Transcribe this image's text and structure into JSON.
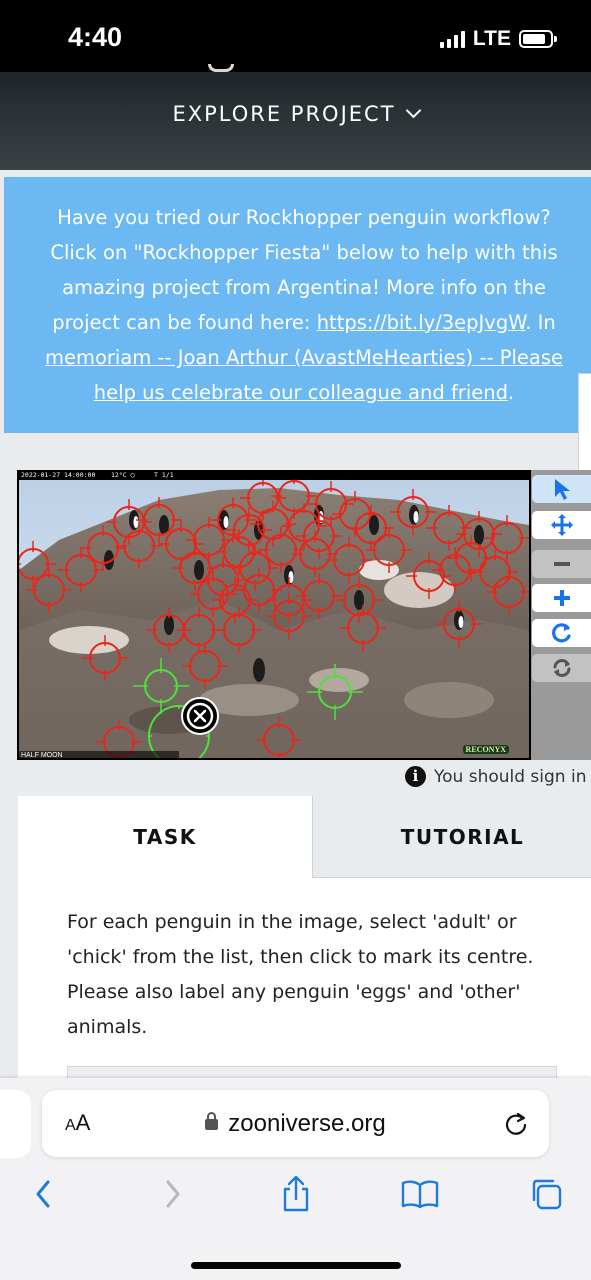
{
  "status_bar": {
    "time": "4:40",
    "network": "LTE"
  },
  "header": {
    "explore_label": "EXPLORE PROJECT"
  },
  "announcement": {
    "line1": "Have you tried our Rockhopper penguin workflow?",
    "line2": "Click on \"Rockhopper Fiesta\" below to help with this",
    "line3": "amazing project from Argentina! More info on the",
    "line4_text": "project can be found here: ",
    "link_url": "https://bit.ly/3epJvgW",
    "line4_after": ". In",
    "link_memoriam_1": "memoriam -- Joan Arthur (AvastMeHearties) -- Please",
    "link_memoriam_2": "help us celebrate our colleague and friend",
    "period": "."
  },
  "subject": {
    "camera_info": "2022-01-27 14:00:00    12°C ◯     T 1/1",
    "location_label": "HALF MOON",
    "watermark": "RECONYX"
  },
  "toolbar": {
    "tools": [
      "pointer-icon",
      "pan-icon",
      "zoom-out-icon",
      "zoom-in-icon",
      "rotate-icon",
      "reset-icon"
    ]
  },
  "notice": {
    "signin_text": "You should sign in"
  },
  "tabs": {
    "task": "TASK",
    "tutorial": "TUTORIAL"
  },
  "task": {
    "instructions": "For each penguin in the image, select 'adult' or 'chick' from the list, then click to mark its centre. Please also label any penguin 'eggs' and 'other' animals."
  },
  "browser": {
    "aa_label": "AA",
    "url": "zooniverse.org"
  },
  "colors": {
    "announcement_bg": "#6bb8f2",
    "marker_red": "#e8261b",
    "marker_green": "#4ee13a",
    "accent_blue": "#1a73e8",
    "safari_blue": "#1f7ae0"
  }
}
